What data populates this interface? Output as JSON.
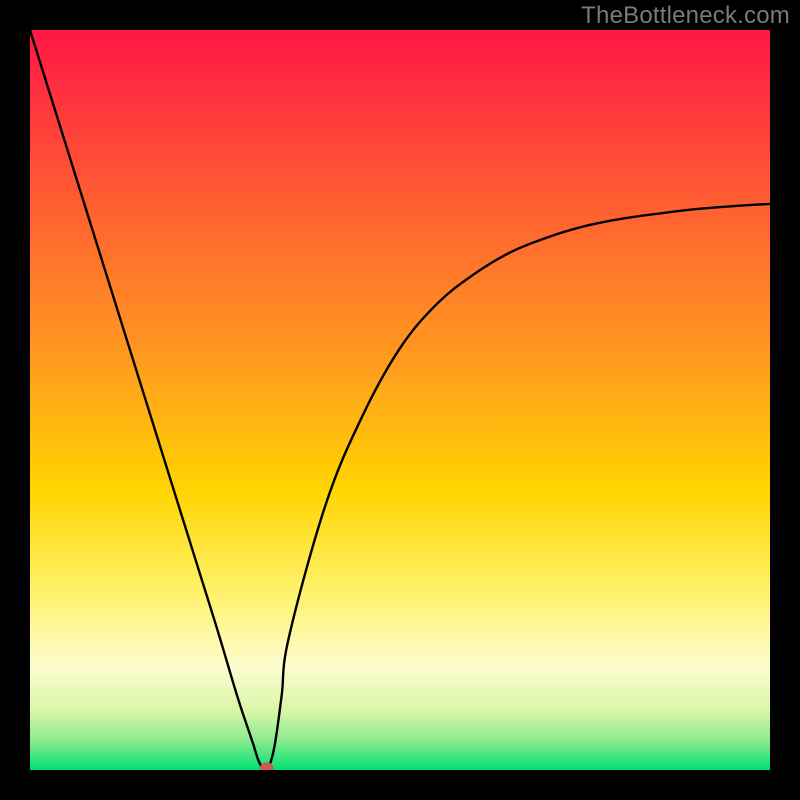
{
  "watermark": "TheBottleneck.com",
  "chart_data": {
    "type": "line",
    "title": "",
    "xlabel": "",
    "ylabel": "",
    "xlim": [
      0,
      100
    ],
    "ylim": [
      0,
      100
    ],
    "grid": false,
    "legend": false,
    "background_gradient": {
      "top_color": "#ff1646",
      "mid_color": "#ffd400",
      "bottom_color": "#00e072",
      "bottom_band_start_pct": 75
    },
    "series": [
      {
        "name": "bottleneck-curve",
        "color": "#000000",
        "x": [
          0,
          5,
          10,
          15,
          20,
          25,
          28,
          30,
          31,
          32,
          33,
          34,
          35,
          40,
          45,
          50,
          55,
          60,
          65,
          70,
          75,
          80,
          85,
          90,
          95,
          100
        ],
        "values": [
          100,
          84,
          68,
          52,
          36,
          20,
          10,
          4,
          1,
          0,
          3,
          10,
          18,
          36,
          48,
          57,
          63,
          67,
          70,
          72,
          73.5,
          74.5,
          75.2,
          75.8,
          76.2,
          76.5
        ]
      }
    ],
    "marker": {
      "name": "optimal-point",
      "x": 32,
      "y": 0,
      "color": "#cf5a4e"
    }
  }
}
